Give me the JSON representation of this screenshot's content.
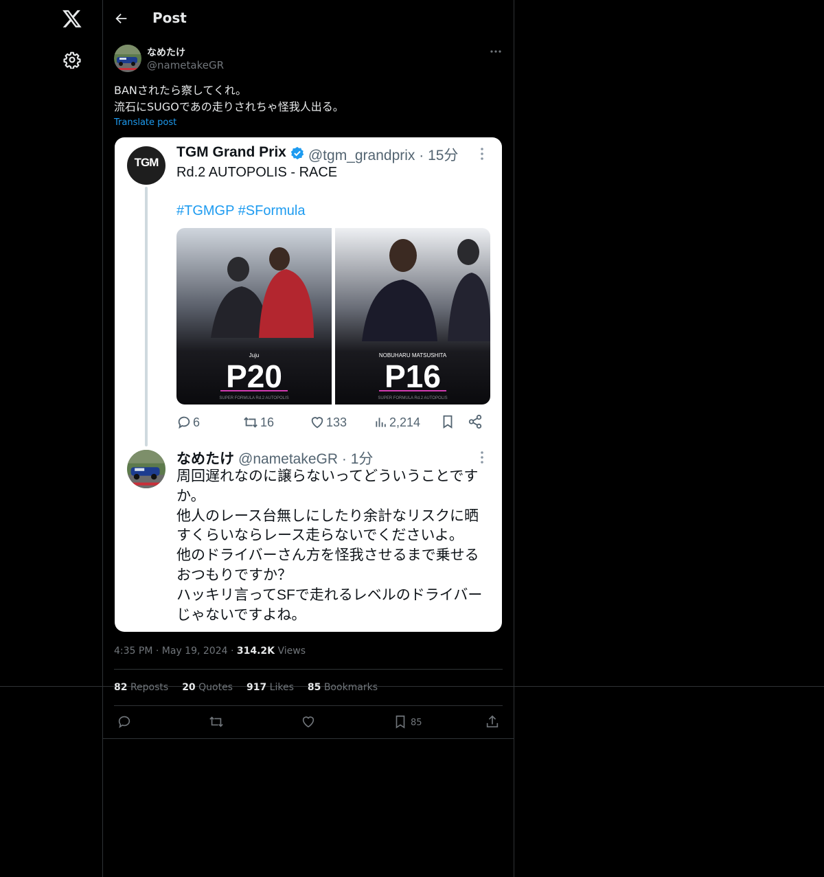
{
  "header": {
    "title": "Post"
  },
  "post": {
    "display_name": "なめたけ",
    "handle": "@nametakeGR",
    "text": "BANされたら察してくれ。\n流石にSUGOであの走りされちゃ怪我人出る。",
    "translate_label": "Translate post",
    "time": "4:35 PM",
    "date": "May 19, 2024",
    "views_count": "314.2K",
    "views_label": "Views",
    "stats": {
      "reposts_count": "82",
      "reposts_label": "Reposts",
      "quotes_count": "20",
      "quotes_label": "Quotes",
      "likes_count": "917",
      "likes_label": "Likes",
      "bookmarks_count": "85",
      "bookmarks_label": "Bookmarks"
    },
    "action_bookmark_count": "85"
  },
  "screenshot_card": {
    "tweet": {
      "name": "TGM Grand Prix",
      "handle_time": "@tgm_grandprix · 15分",
      "avatar_text": "TGM",
      "text": "Rd.2 AUTOPOLIS - RACE",
      "hashtags": "#TGMGP #SFormula",
      "images": [
        {
          "driver": "Juju",
          "position": "P20",
          "footer": "SUPER FORMULA Rd.2 AUTOPOLIS"
        },
        {
          "driver": "NOBUHARU MATSUSHITA",
          "position": "P16",
          "footer": "SUPER FORMULA Rd.2 AUTOPOLIS"
        }
      ],
      "replies": "6",
      "retweets": "16",
      "likes": "133",
      "views": "2,214"
    },
    "reply": {
      "name": "なめたけ",
      "handle_time": "@nametakeGR · 1分",
      "text": "周回遅れなのに譲らないってどういうことです\nか。\n他人のレース台無しにしたり余計なリスクに晒\nすくらいならレース走らないでくださいよ。\n他のドライバーさん方を怪我させるまで乗せる\nおつもりですか？\nハッキリ言ってSFで走れるレベルのドライバー\nじゃないですよね。"
    }
  },
  "colors": {
    "accent": "#1d9bf0",
    "background": "#000000",
    "border": "#2f3336",
    "muted": "#71767b"
  }
}
